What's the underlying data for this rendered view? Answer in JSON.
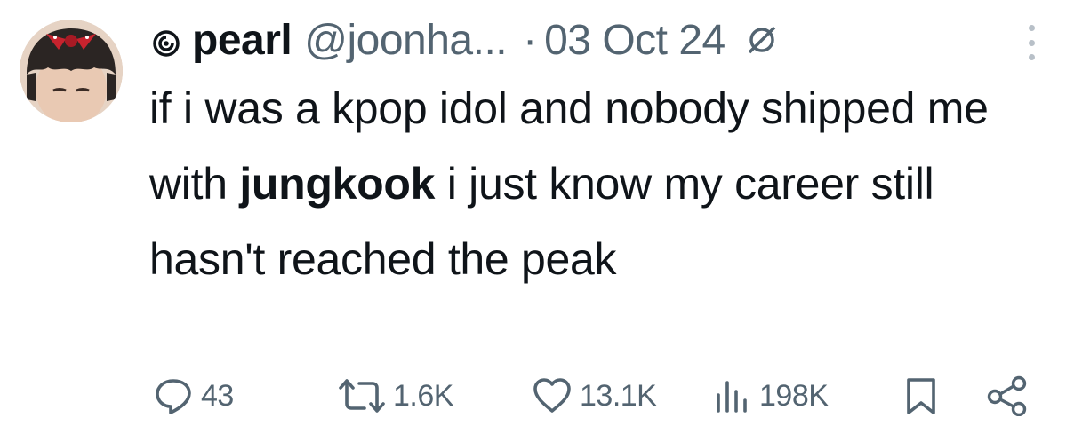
{
  "author": {
    "display_name": "pearl",
    "handle": "@joonha...",
    "separator": "·",
    "date": "03 Oct 24"
  },
  "icons": {
    "badge": "swirl-badge-icon",
    "edited": "no-edit-icon",
    "more": "more-options-icon",
    "reply": "reply-icon",
    "retweet": "retweet-icon",
    "like": "heart-icon",
    "views": "views-bar-icon",
    "bookmark": "bookmark-icon",
    "share": "share-icon"
  },
  "tweet": {
    "text_1": "if i was a kpop idol and nobody shipped me with ",
    "text_bold": "jungkook",
    "text_2": " i just know my career still hasn't reached the peak"
  },
  "stats": {
    "replies": "43",
    "retweets": "1.6K",
    "likes": "13.1K",
    "views": "198K"
  },
  "colors": {
    "text": "#0f1419",
    "muted": "#536471"
  }
}
